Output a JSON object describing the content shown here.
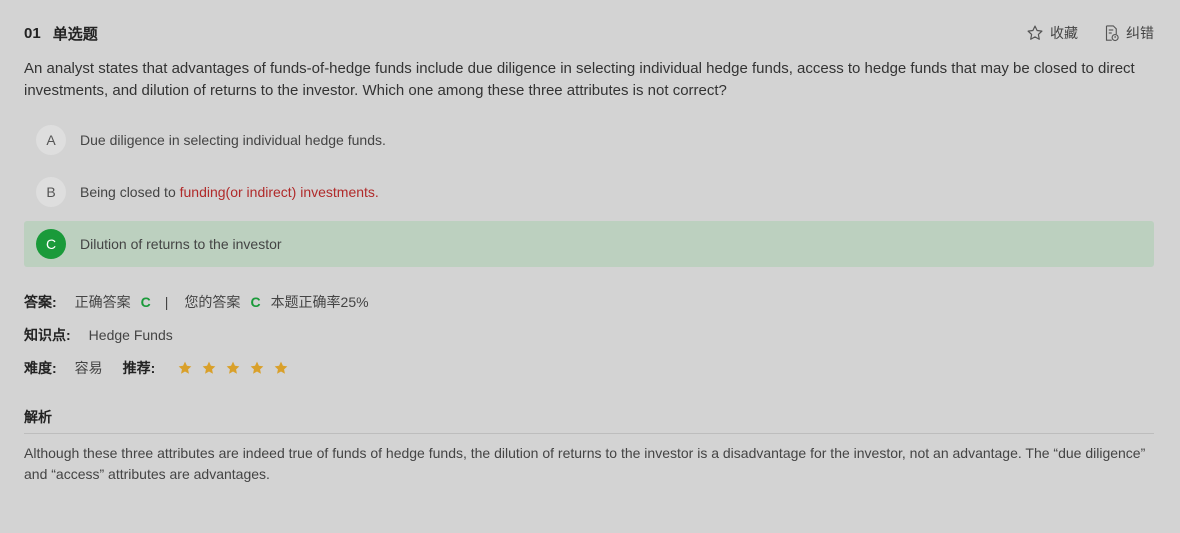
{
  "question": {
    "number": "01",
    "type": "单选题",
    "stem": "An analyst states that advantages of funds-of-hedge funds include due diligence in selecting individual hedge funds, access to hedge funds that may be closed to direct investments, and dilution of returns to the investor. Which one among these three attributes is not correct?"
  },
  "tools": {
    "favorite_label": "收藏",
    "report_label": "纠错"
  },
  "options": [
    {
      "letter": "A",
      "text": "Due diligence in selecting individual hedge funds."
    },
    {
      "letter": "B",
      "text_before": "Being closed to ",
      "text_highlight": "funding(or indirect) investments."
    },
    {
      "letter": "C",
      "text": "Dilution of returns to the investor",
      "state": "selected-correct"
    }
  ],
  "answer": {
    "label": "答案:",
    "correct_label": "正确答案",
    "correct_value": "C",
    "separator": "|",
    "yours_label": "您的答案",
    "yours_value": "C",
    "accuracy": "本题正确率25%"
  },
  "knowledge": {
    "label": "知识点:",
    "value": "Hedge Funds"
  },
  "difficulty": {
    "label": "难度:",
    "value": "容易",
    "recommend_label": "推荐:",
    "rating": 5,
    "max_rating": 5
  },
  "analysis": {
    "title": "解析",
    "text": "Although these three attributes are indeed true of funds of hedge funds, the dilution of returns to the investor is a disadvantage for the investor, not an advantage. The “due diligence” and “access” attributes are advantages."
  },
  "colors": {
    "background": "#d3d3d3",
    "correct_green": "#1a9a3a",
    "correct_row_bg": "#bcd0bf",
    "highlight_red": "#b02a2a",
    "star_gold": "#d9a02a"
  },
  "icons": [
    "star-outline-icon",
    "report-error-icon",
    "star-icon"
  ]
}
